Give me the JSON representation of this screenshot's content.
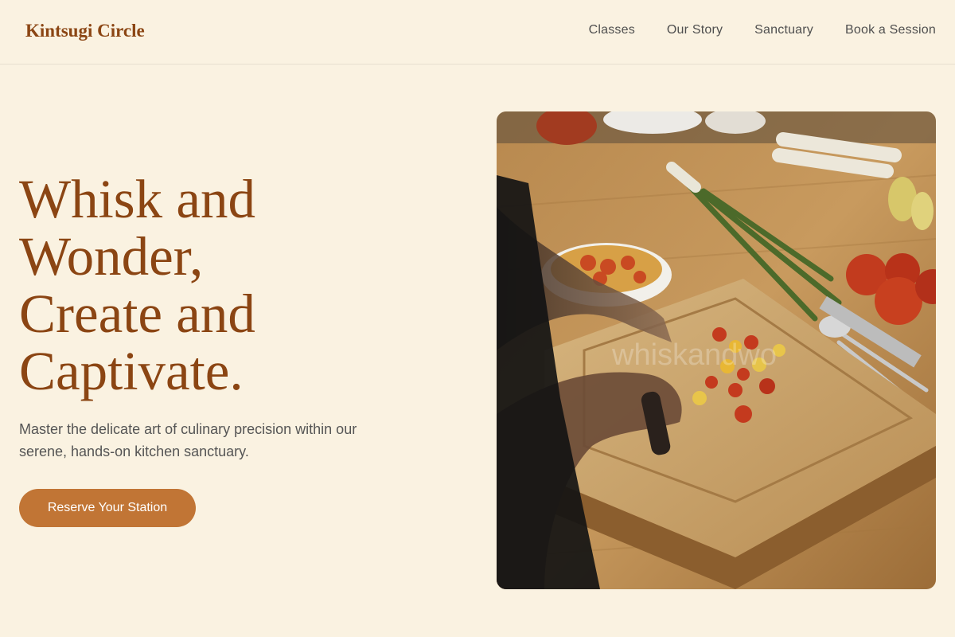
{
  "header": {
    "brand": "Kintsugi Circle",
    "nav": [
      {
        "label": "Classes"
      },
      {
        "label": "Our Story"
      },
      {
        "label": "Sanctuary"
      },
      {
        "label": "Book a Session"
      }
    ]
  },
  "hero": {
    "title_lines": [
      "Whisk and",
      "Wonder,",
      "Create and",
      "Captivate."
    ],
    "subtitle": "Master the delicate art of culinary precision within our serene, hands-on kitchen sanctuary.",
    "cta_label": "Reserve Your Station",
    "image_watermark": "whiskandwo"
  },
  "colors": {
    "background": "#faf2e1",
    "brand": "#8b4513",
    "accent": "#c17535"
  }
}
